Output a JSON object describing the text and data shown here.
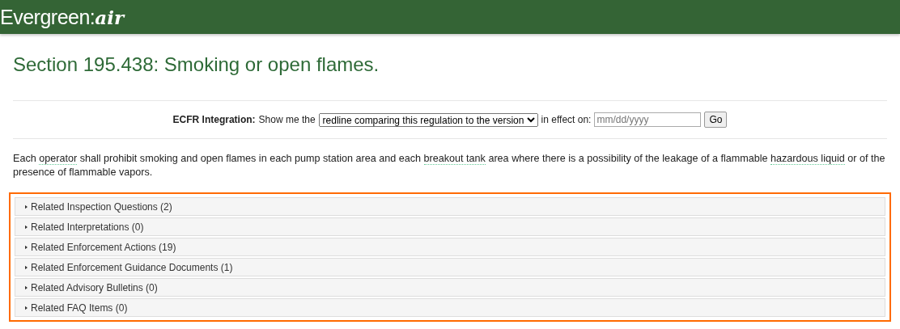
{
  "header": {
    "logo": {
      "name": "Evergreen:",
      "suffix": "air"
    }
  },
  "title": "Section 195.438: Smoking or open flames.",
  "ecfr": {
    "label": "ECFR Integration:",
    "prefix": "Show me the",
    "select": "redline comparing this regulation to the version",
    "middle": "in effect on:",
    "date_placeholder": "mm/dd/yyyy",
    "button": "Go"
  },
  "paragraph": [
    {
      "text": "Each ",
      "term": false
    },
    {
      "text": "operator",
      "term": true
    },
    {
      "text": " shall prohibit smoking and open flames in each pump station area and each ",
      "term": false
    },
    {
      "text": "breakout tank",
      "term": true
    },
    {
      "text": " area where there is a possibility of the leakage of a flammable ",
      "term": false
    },
    {
      "text": "hazardous liquid",
      "term": true
    },
    {
      "text": " or of the presence of flammable vapors.",
      "term": false
    }
  ],
  "sections": {
    "highlighted": true,
    "items": [
      {
        "label": "Related Inspection Questions (2)",
        "expanded": false
      },
      {
        "label": "Related Interpretations (0)",
        "expanded": false
      },
      {
        "label": "Related Enforcement Actions (19)",
        "expanded": false
      },
      {
        "label": "Related Enforcement Guidance Documents (1)",
        "expanded": false
      },
      {
        "label": "Related Advisory Bulletins (0)",
        "expanded": false
      },
      {
        "label": "Related FAQ Items (0)",
        "expanded": false
      }
    ]
  }
}
